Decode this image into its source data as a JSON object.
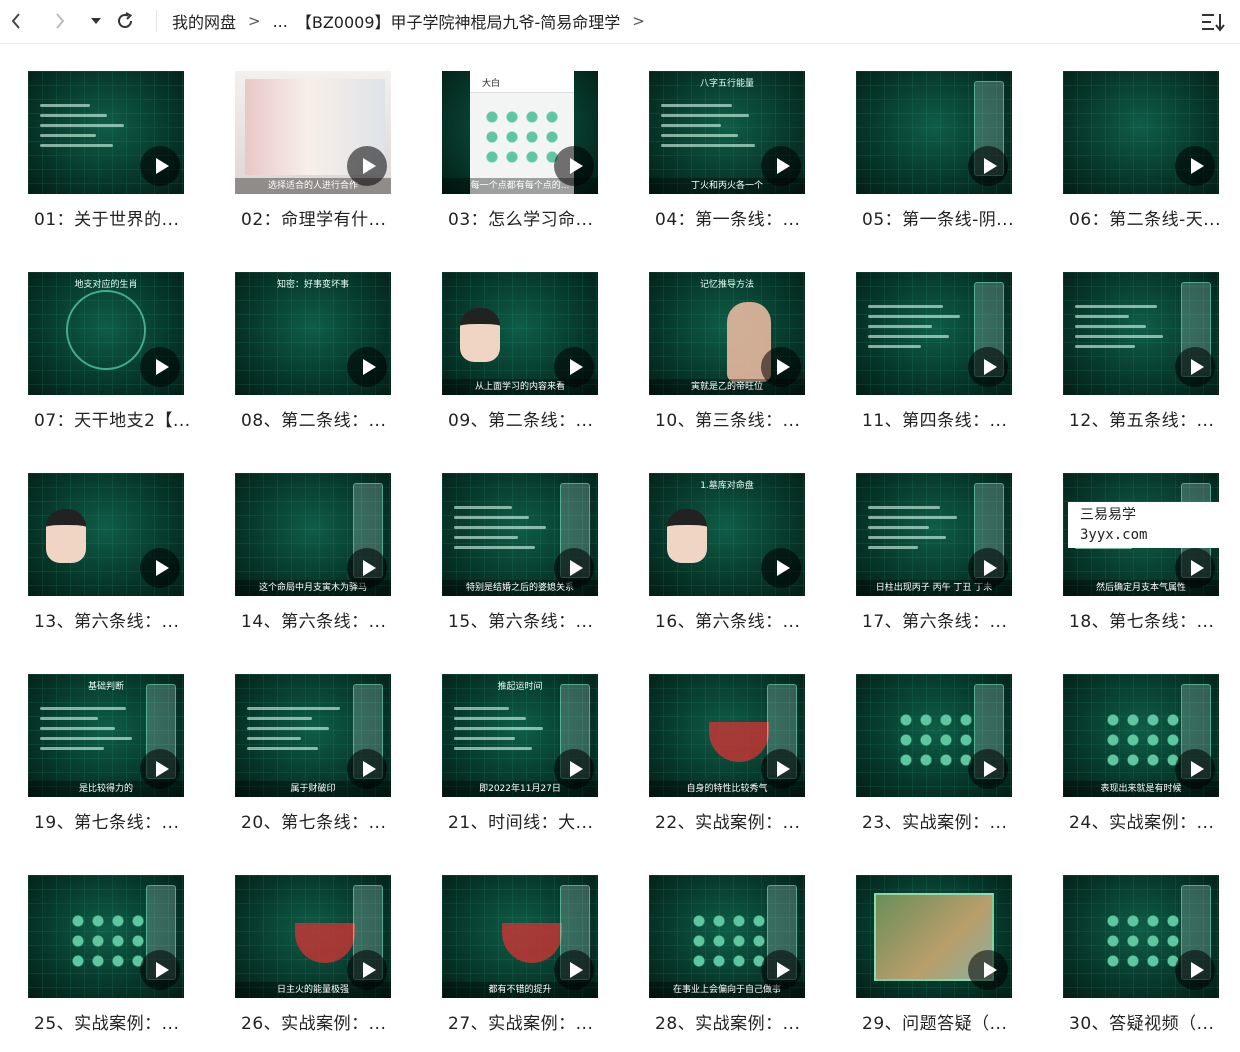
{
  "toolbar": {
    "back_icon": "chevron-left-icon",
    "forward_icon": "chevron-right-icon",
    "dropdown_icon": "caret-down-icon",
    "refresh_icon": "refresh-icon",
    "sort_icon": "sort-icon"
  },
  "breadcrumb": {
    "root": "我的网盘",
    "sep": ">",
    "ellipsis": "...",
    "current": "【BZ0009】甲子学院神棍局九爷-简易命理学"
  },
  "watermark": {
    "line1": "三易易学",
    "line2": "3yyx.com"
  },
  "items": [
    {
      "title": "01：关于世界的...",
      "caption": "",
      "head": "",
      "style": "dark-text"
    },
    {
      "title": "02：命理学有什...",
      "caption": "选择适合的人进行合作",
      "head": "",
      "style": "people"
    },
    {
      "title": "03：怎么学习命...",
      "caption": "每一个点都有每个点的...",
      "head": "大白",
      "style": "phone"
    },
    {
      "title": "04：第一条线：...",
      "caption": "丁火和丙火各一个",
      "head": "八字五行能量",
      "style": "text"
    },
    {
      "title": "05：第一条线-阴...",
      "caption": "",
      "head": "",
      "style": "panel"
    },
    {
      "title": "06：第二条线-天...",
      "caption": "",
      "head": "",
      "style": "plain"
    },
    {
      "title": "07：天干地支2【...",
      "caption": "",
      "head": "地支对应的生肖",
      "style": "ring"
    },
    {
      "title": "08、第二条线：...",
      "caption": "",
      "head": "知密：好事变坏事",
      "style": "plain"
    },
    {
      "title": "09、第二条线：...",
      "caption": "从上面学习的内容来看",
      "head": "",
      "style": "avatar"
    },
    {
      "title": "10、第三条线：...",
      "caption": "寅就是乙的帝旺位",
      "head": "记忆推导方法",
      "style": "hand"
    },
    {
      "title": "11、第四条线：...",
      "caption": "",
      "head": "",
      "style": "text-panel"
    },
    {
      "title": "12、第五条线：...",
      "caption": "",
      "head": "",
      "style": "text-panel"
    },
    {
      "title": "13、第六条线：...",
      "caption": "",
      "head": "",
      "style": "avatar"
    },
    {
      "title": "14、第六条线：...",
      "caption": "这个命局中月支寅木为驿马",
      "head": "",
      "style": "panel"
    },
    {
      "title": "15、第六条线：...",
      "caption": "特别是结婚之后的婆媳关系",
      "head": "",
      "style": "text-panel"
    },
    {
      "title": "16、第六条线：...",
      "caption": "",
      "head": "1.墓库对命盘",
      "style": "avatar"
    },
    {
      "title": "17、第六条线：...",
      "caption": "日柱出现丙子 丙午 丁丑 丁未",
      "head": "",
      "style": "text-panel"
    },
    {
      "title": "18、第七条线：...",
      "caption": "然后确定月支本气属性",
      "head": "",
      "style": "text-panel"
    },
    {
      "title": "19、第七条线：...",
      "caption": "是比较得力的",
      "head": "基础判断",
      "style": "text-panel"
    },
    {
      "title": "20、第七条线：...",
      "caption": "属于财破印",
      "head": "",
      "style": "text-panel"
    },
    {
      "title": "21、时间线：大...",
      "caption": "即2022年11月27日",
      "head": "推起运时间",
      "style": "text-panel"
    },
    {
      "title": "22、实战案例：...",
      "caption": "自身的特性比较秀气",
      "head": "",
      "style": "chart"
    },
    {
      "title": "23、实战案例：...",
      "caption": "",
      "head": "",
      "style": "dots"
    },
    {
      "title": "24、实战案例：...",
      "caption": "表现出来就是有时候",
      "head": "",
      "style": "dots"
    },
    {
      "title": "25、实战案例：...",
      "caption": "",
      "head": "",
      "style": "dots"
    },
    {
      "title": "26、实战案例：...",
      "caption": "日主火的能量极强",
      "head": "",
      "style": "chart"
    },
    {
      "title": "27、实战案例：...",
      "caption": "都有不错的提升",
      "head": "",
      "style": "chart"
    },
    {
      "title": "28、实战案例：...",
      "caption": "在事业上会偏向于自己做事",
      "head": "",
      "style": "dots"
    },
    {
      "title": "29、问题答疑（...",
      "caption": "",
      "head": "",
      "style": "map"
    },
    {
      "title": "30、答疑视频（...",
      "caption": "",
      "head": "",
      "style": "dots"
    }
  ]
}
